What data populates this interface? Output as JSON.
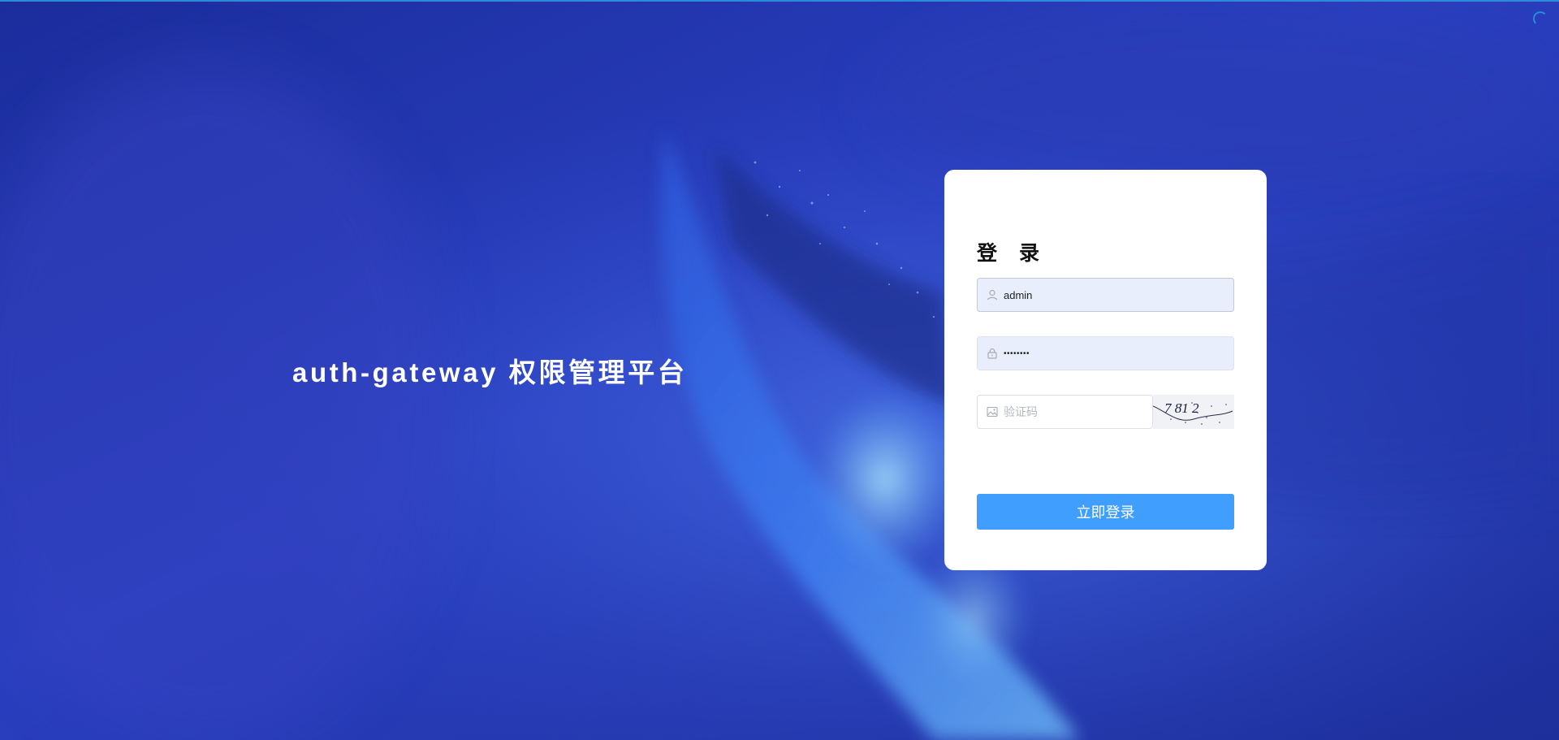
{
  "platform_title": "auth-gateway 权限管理平台",
  "login": {
    "title": "登 录",
    "username": {
      "value": "admin",
      "icon": "user-icon"
    },
    "password": {
      "value": "••••••••",
      "icon": "lock-icon"
    },
    "captcha": {
      "placeholder": "验证码",
      "icon": "image-icon",
      "image_text": "7 81 2"
    },
    "submit_label": "立即登录"
  },
  "colors": {
    "background": "#2339b4",
    "accent": "#409eff",
    "input_fill": "#e8eefb",
    "progress": "#2b8bd9"
  }
}
